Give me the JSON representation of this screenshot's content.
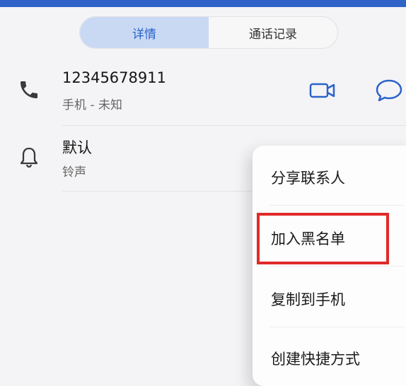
{
  "colors": {
    "accent": "#2b63c9",
    "highlight": "#e02a2a",
    "icon": "#3a3a3a",
    "action_icon": "#2b63c9"
  },
  "tabs": [
    {
      "label": "详情",
      "active": true
    },
    {
      "label": "通话记录",
      "active": false
    }
  ],
  "phone_row": {
    "icon": "phone-icon",
    "number": "12345678911",
    "subtitle": "手机 - 未知",
    "actions": [
      "video-call-icon",
      "message-icon"
    ]
  },
  "ringtone_row": {
    "icon": "bell-icon",
    "title": "默认",
    "subtitle": "铃声"
  },
  "menu": {
    "items": [
      {
        "label": "分享联系人"
      },
      {
        "label": "加入黑名单",
        "highlighted": true
      },
      {
        "label": "复制到手机"
      },
      {
        "label": "创建快捷方式"
      }
    ]
  }
}
